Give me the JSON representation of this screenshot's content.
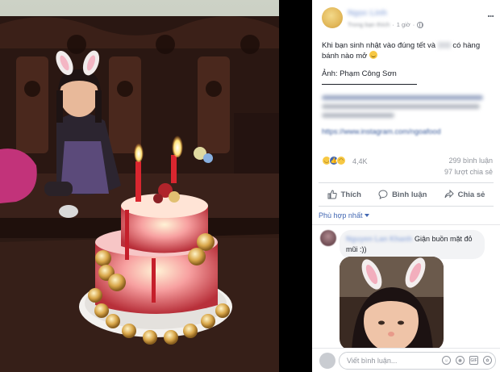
{
  "post": {
    "author": "Ngọc Linh",
    "meta_blurred": "Trong bạn thích",
    "time": "1 giờ",
    "more_label": "...",
    "text_before": "Khi bạn sinh nhật vào đúng tết và",
    "text_after": "có hàng bánh nào mở",
    "credit": "Ảnh: Phạm Công Sơn",
    "blurred_lines": [
      "Follow Instagram của Ngoa Food để được thấy",
      "nhiều món ăn ngon và kiếm được nhiều món ăn",
      "chắn nhé"
    ],
    "link_blurred": "https://www.instagram.com/ngoafood"
  },
  "stats": {
    "reaction_icons": [
      "haha-icon",
      "like-icon",
      "sad-icon"
    ],
    "reactions": "4,4K",
    "comments": "299 bình luận",
    "shares": "97 lượt chia sẻ"
  },
  "actions": {
    "like": "Thích",
    "comment": "Bình luận",
    "share": "Chia sẻ"
  },
  "sort": {
    "label": "Phù hợp nhất"
  },
  "comment": {
    "name_blurred": "Nguyen Lan Khanh",
    "text": "Giận buồn mặt đỏ mũi :))"
  },
  "composer": {
    "placeholder": "Viết bình luận..."
  },
  "colors": {
    "link_blue": "#4267b2",
    "muted": "#90949c",
    "text": "#1d2129"
  }
}
